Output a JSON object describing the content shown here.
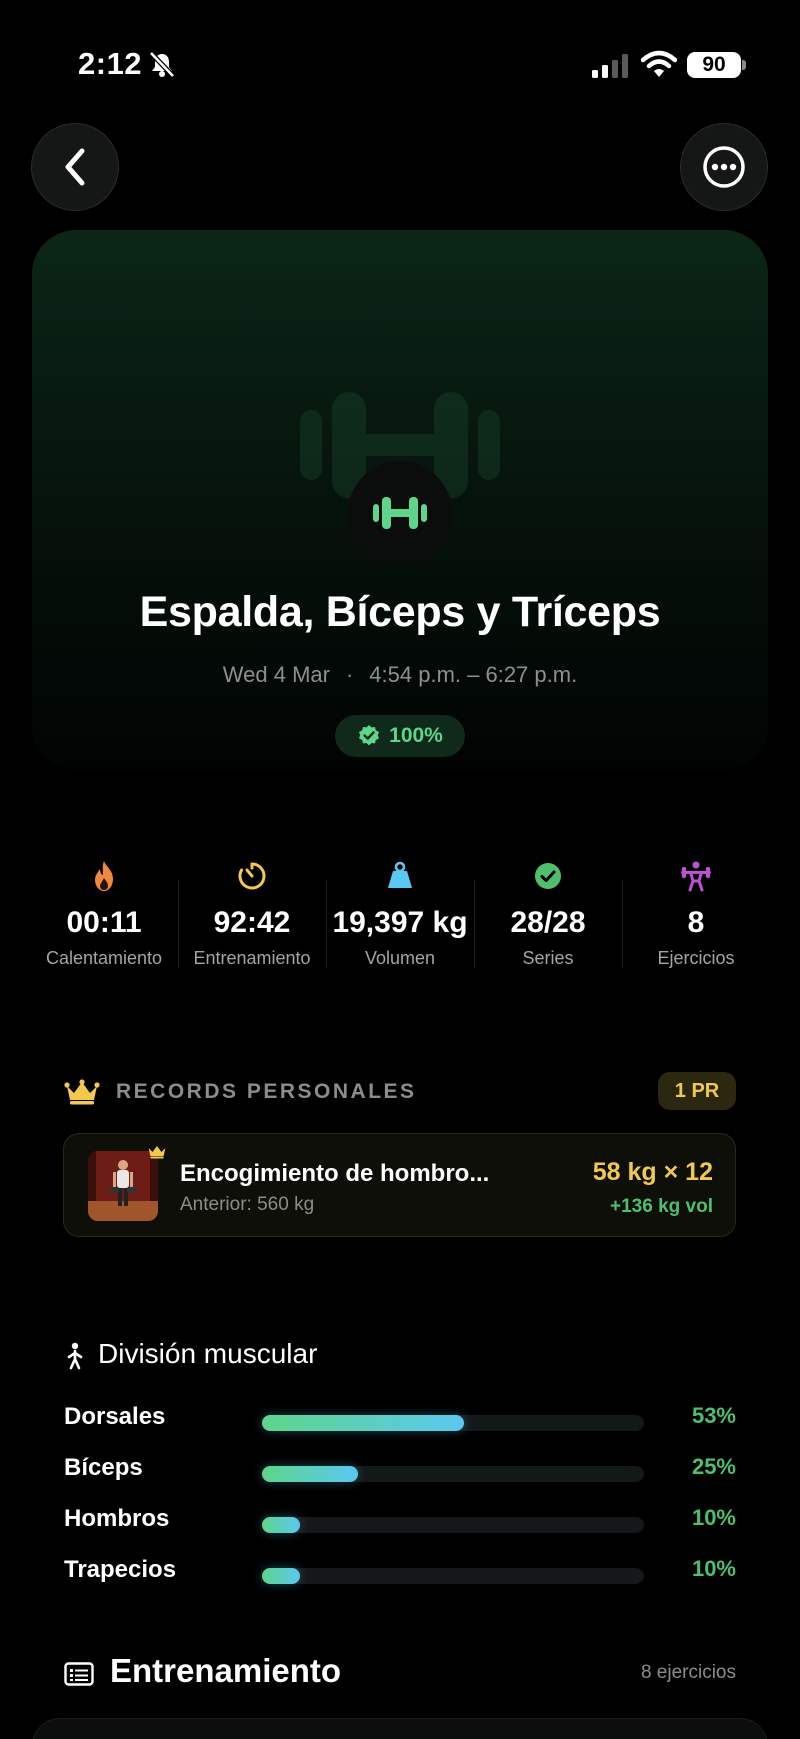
{
  "status_bar": {
    "time": "2:12",
    "battery": "90"
  },
  "hero": {
    "title": "Espalda, Bíceps y Tríceps",
    "date": "Wed 4 Mar",
    "separator": "·",
    "time_range": "4:54 p.m. – 6:27 p.m.",
    "completion": "100%"
  },
  "stats": [
    {
      "icon": "flame-icon",
      "value": "00:11",
      "label": "Calentamiento",
      "color": "#f0883e"
    },
    {
      "icon": "timer-icon",
      "value": "92:42",
      "label": "Entrenamiento",
      "color": "#f2c94c"
    },
    {
      "icon": "weight-icon",
      "value": "19,397 kg",
      "label": "Volumen",
      "color": "#5ac8f0"
    },
    {
      "icon": "check-circle-icon",
      "value": "28/28",
      "label": "Series",
      "color": "#4fbf6e"
    },
    {
      "icon": "lifter-icon",
      "value": "8",
      "label": "Ejercicios",
      "color": "#c04fd8"
    }
  ],
  "records": {
    "title": "RECORDS PERSONALES",
    "badge": "1 PR",
    "item": {
      "name": "Encogimiento de hombro...",
      "previous": "Anterior: 560 kg",
      "value": "58 kg × 12",
      "volume": "+136 kg vol"
    }
  },
  "muscle_split": {
    "title": "División muscular",
    "items": [
      {
        "name": "Dorsales",
        "percent": "53%",
        "fraction": 0.53
      },
      {
        "name": "Bíceps",
        "percent": "25%",
        "fraction": 0.25
      },
      {
        "name": "Hombros",
        "percent": "10%",
        "fraction": 0.1
      },
      {
        "name": "Trapecios",
        "percent": "10%",
        "fraction": 0.1
      }
    ]
  },
  "workout": {
    "title": "Entrenamiento",
    "count": "8 ejercicios"
  },
  "colors": {
    "accent_green": "#5ed58a",
    "gold": "#f2c94c",
    "background": "#000000"
  }
}
